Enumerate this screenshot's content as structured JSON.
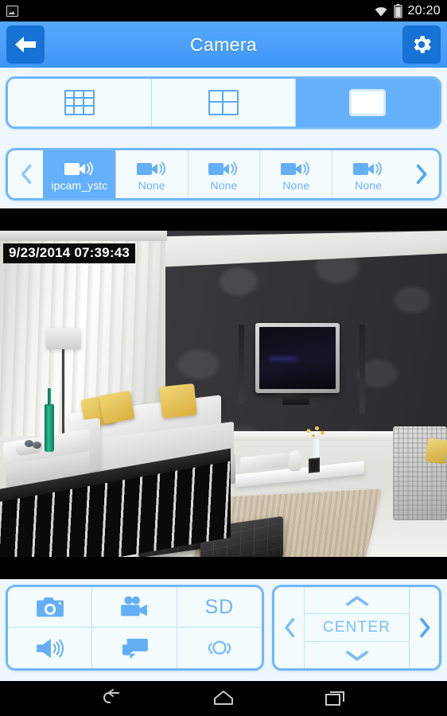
{
  "status_bar": {
    "notification_icon": "image-icon",
    "wifi_icon": "wifi-icon",
    "battery_icon": "battery-icon",
    "time": "20:20"
  },
  "title_bar": {
    "back_icon": "arrow-left-icon",
    "title": "Camera",
    "settings_icon": "gear-icon"
  },
  "layout_selector": {
    "options": [
      {
        "name": "grid-9",
        "icon": "grid-3x3-icon",
        "selected": false
      },
      {
        "name": "grid-4",
        "icon": "grid-2x2-icon",
        "selected": false
      },
      {
        "name": "single",
        "icon": "single-pane-icon",
        "selected": true
      }
    ]
  },
  "camera_strip": {
    "prev_icon": "chevron-left-icon",
    "next_icon": "chevron-right-icon",
    "items": [
      {
        "label": "ipcam_ystc",
        "icon": "camcorder-icon",
        "selected": true
      },
      {
        "label": "None",
        "icon": "camcorder-icon",
        "selected": false
      },
      {
        "label": "None",
        "icon": "camcorder-icon",
        "selected": false
      },
      {
        "label": "None",
        "icon": "camcorder-icon",
        "selected": false
      },
      {
        "label": "None",
        "icon": "camcorder-icon",
        "selected": false
      }
    ]
  },
  "video": {
    "timestamp": "9/23/2014 07:39:43",
    "scene_description": "living room with grey sofa, yellow cushions, black leather ottomans, wall mounted tv on dark damask wall"
  },
  "controls": {
    "buttons": [
      {
        "name": "snapshot",
        "icon": "photo-camera-icon",
        "label": ""
      },
      {
        "name": "record",
        "icon": "video-camera-icon",
        "label": ""
      },
      {
        "name": "quality",
        "icon": "",
        "label": "SD"
      },
      {
        "name": "audio",
        "icon": "speaker-icon",
        "label": ""
      },
      {
        "name": "talk",
        "icon": "chat-bubble-icon",
        "label": ""
      },
      {
        "name": "preset",
        "icon": "pan-rotate-icon",
        "label": ""
      }
    ]
  },
  "dpad": {
    "up_icon": "chevron-up-icon",
    "down_icon": "chevron-down-icon",
    "left_icon": "chevron-left-icon",
    "right_icon": "chevron-right-icon",
    "center_label": "CENTER"
  },
  "nav_bar": {
    "back_icon": "nav-back-icon",
    "home_icon": "nav-home-icon",
    "recents_icon": "nav-recents-icon"
  },
  "colors": {
    "accent": "#54a8fb",
    "accent_dark": "#1672d4",
    "panel_border": "#6fb7fb",
    "panel_fill": "#f4fbff",
    "icon_blue": "#6cb3f7"
  }
}
